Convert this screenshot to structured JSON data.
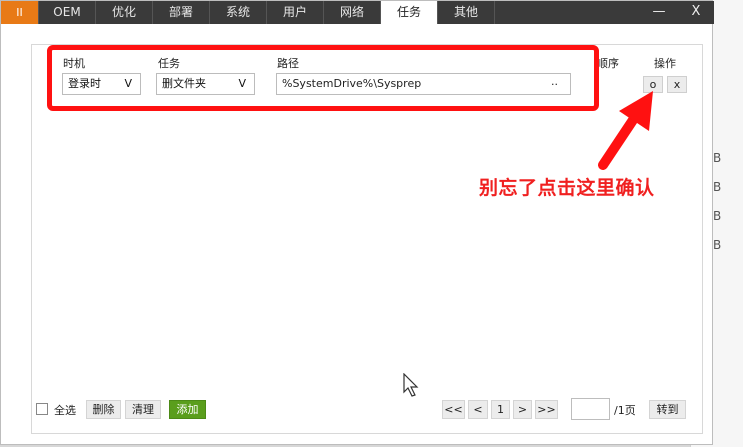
{
  "titlebar": {
    "logo": "II",
    "tabs": [
      "OEM",
      "优化",
      "部署",
      "系统",
      "用户",
      "网络",
      "任务",
      "其他"
    ],
    "active_tab": "任务",
    "minimize": "—",
    "close": "X"
  },
  "table": {
    "headers": {
      "timing": "时机",
      "task": "任务",
      "path": "路径",
      "order": "顺序",
      "action": "操作"
    },
    "row": {
      "timing": "登录时",
      "task": "删文件夹",
      "path": "%SystemDrive%\\Sysprep",
      "path_button": "..",
      "confirm": "o",
      "remove": "x"
    },
    "dropdown_arrow": "V"
  },
  "annotation": "别忘了点击这里确认",
  "bottom": {
    "select_all": "全选",
    "delete": "删除",
    "clear": "清理",
    "add": "添加",
    "first": "<<",
    "prev": "<",
    "page": "1",
    "next": ">",
    "last": ">>",
    "page_total": "/1页",
    "goto": "转到"
  },
  "background_window_letters": [
    "B",
    "B",
    "B",
    "B"
  ],
  "colors": {
    "titlebar": "#3a3a3a",
    "logo": "#e87a16",
    "highlight": "#ff1111",
    "add_button": "#5a9e1c"
  }
}
